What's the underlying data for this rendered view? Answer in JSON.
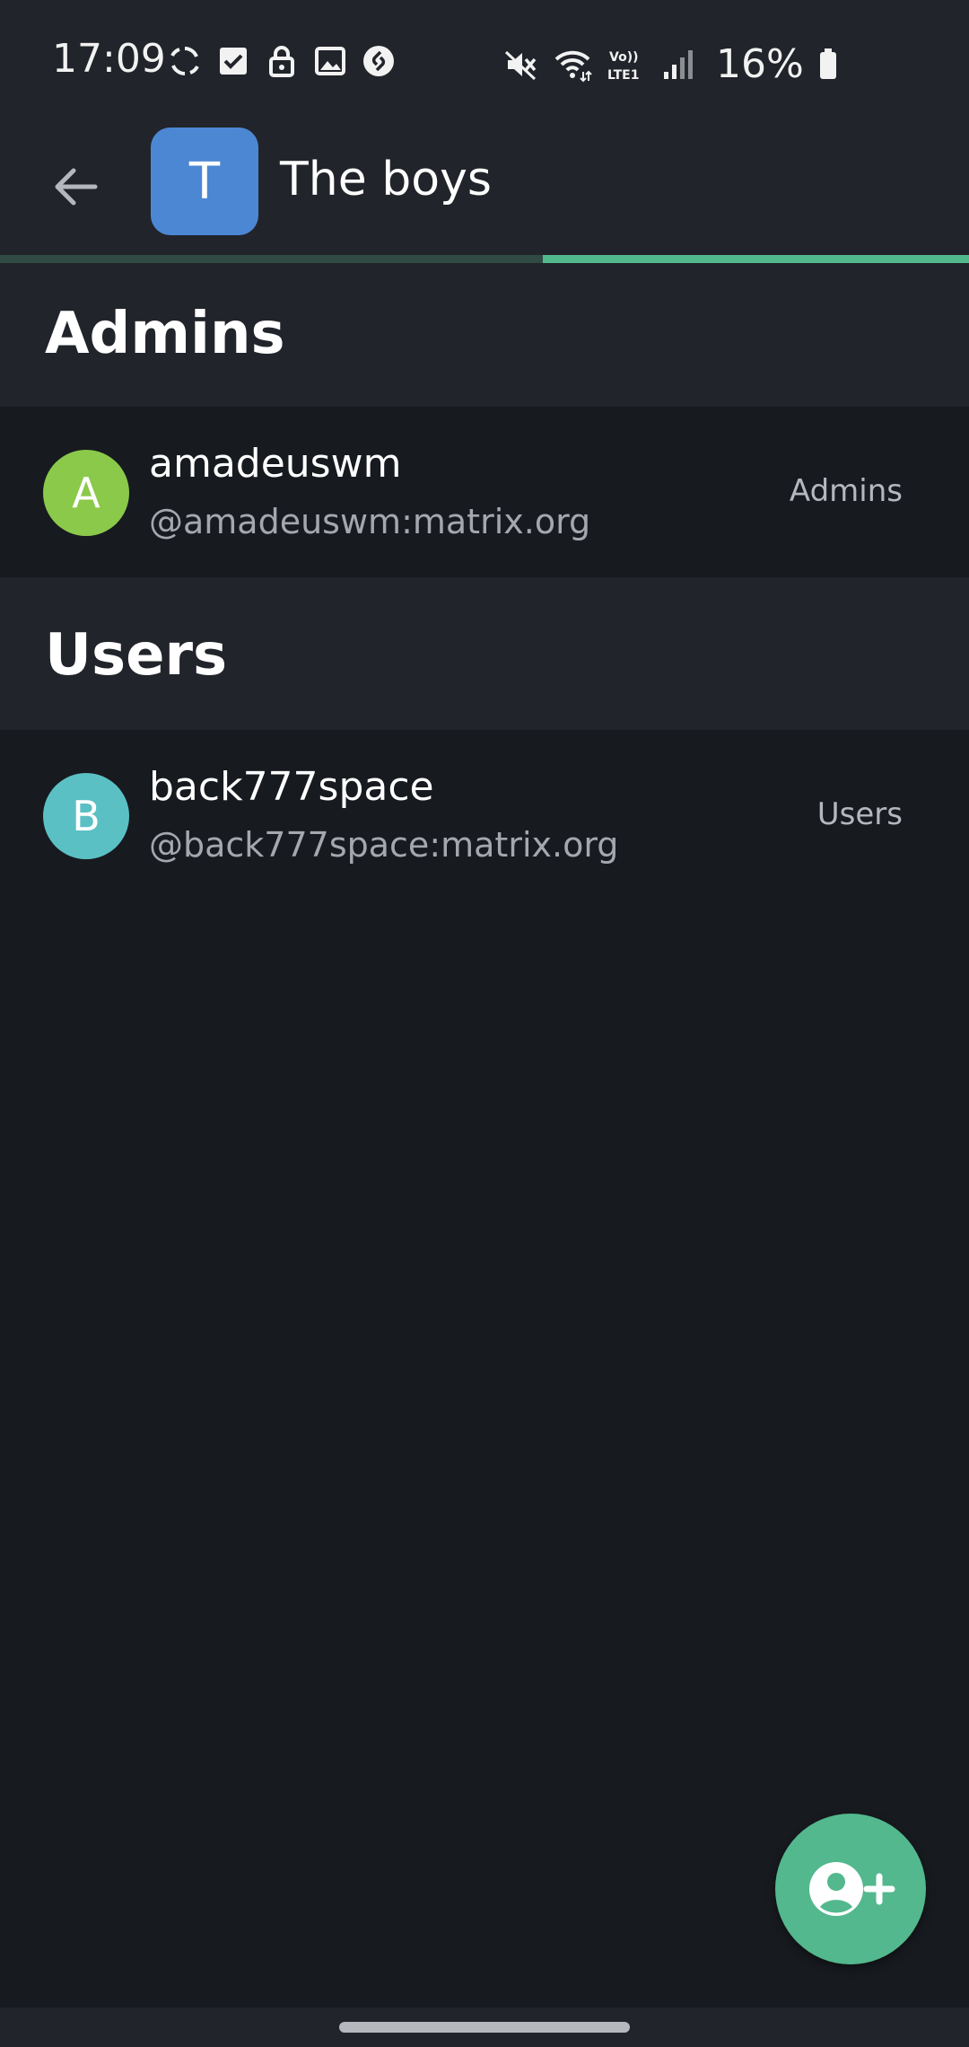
{
  "status_bar": {
    "time": "17:09",
    "battery": "16%",
    "icons_left": [
      "sync-icon",
      "checkbox-icon",
      "lock-icon",
      "image-icon",
      "shazam-icon"
    ],
    "icons_right": [
      "mute-icon",
      "wifi-icon",
      "volte-icon",
      "signal-icon",
      "battery-icon"
    ],
    "volte_label": "Vo))\nLTE1"
  },
  "app_bar": {
    "room_initial": "T",
    "room_name": "The boys",
    "room_color": "#4c87d4",
    "load_progress": 0.44
  },
  "sections": [
    {
      "title": "Admins",
      "members": [
        {
          "initial": "A",
          "display_name": "amadeuswm",
          "user_id": "@amadeuswm:matrix.org",
          "role": "Admins",
          "avatar_color": "#8bc94a"
        }
      ]
    },
    {
      "title": "Users",
      "members": [
        {
          "initial": "B",
          "display_name": "back777space",
          "user_id": "@back777space:matrix.org",
          "role": "Users",
          "avatar_color": "#5bc0c4"
        }
      ]
    }
  ],
  "fab": {
    "icon": "add-person-icon",
    "color": "#53b88d"
  }
}
